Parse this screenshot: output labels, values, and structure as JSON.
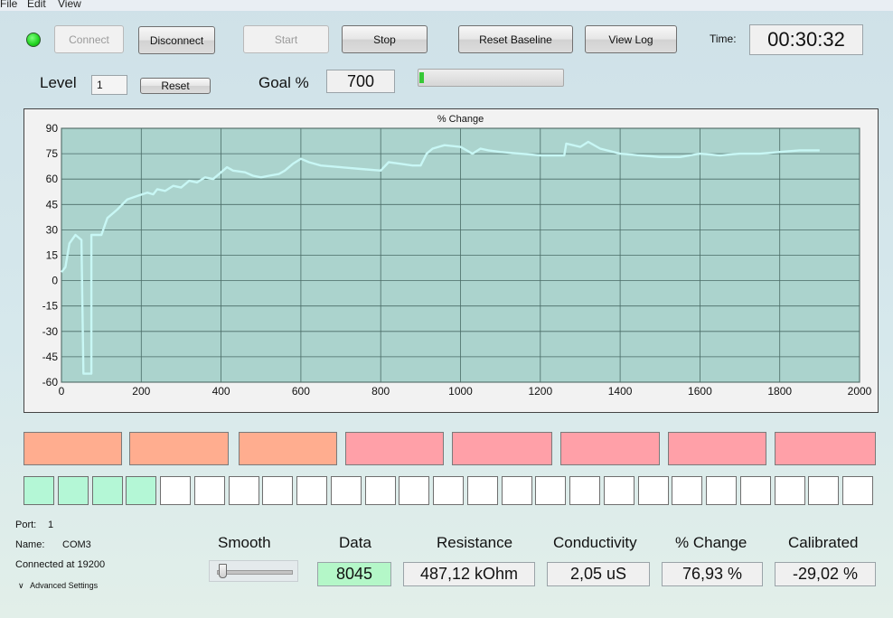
{
  "menu": [
    "File",
    "Edit",
    "View"
  ],
  "colors": {
    "led": "#1fd31f",
    "plot_bg": "#abd3cd",
    "series": "#c8f7f5",
    "orange": "#ffad8f",
    "pink": "#ffa0a8",
    "green_cell": "#b4f7d6",
    "progress": "#37c837",
    "data_bg": "#b4f7c8"
  },
  "toolbar": {
    "connect": "Connect",
    "disconnect": "Disconnect",
    "start": "Start",
    "stop": "Stop",
    "reset_baseline": "Reset Baseline",
    "view_log": "View Log",
    "time_label": "Time:",
    "time_value": "00:30:32"
  },
  "level": {
    "label": "Level",
    "value": "1",
    "reset": "Reset"
  },
  "goal": {
    "label": "Goal %",
    "value": "700",
    "progress": 0.011
  },
  "chart_data": {
    "type": "line",
    "title": "% Change",
    "xlabel": "",
    "ylabel": "",
    "xlim": [
      0,
      2000
    ],
    "ylim": [
      -60,
      90
    ],
    "xticks": [
      0,
      200,
      400,
      600,
      800,
      1000,
      1200,
      1400,
      1600,
      1800,
      2000
    ],
    "yticks": [
      90,
      75,
      60,
      45,
      30,
      15,
      0,
      -15,
      -30,
      -45,
      -60
    ],
    "grid": true,
    "series": [
      {
        "x": [
          0,
          10,
          20,
          35,
          50,
          55,
          55,
          75,
          75,
          100,
          115,
          140,
          165,
          190,
          215,
          230,
          240,
          260,
          280,
          300,
          320,
          340,
          360,
          380,
          400,
          415,
          430,
          460,
          480,
          500,
          520,
          545,
          560,
          580,
          600,
          620,
          650,
          700,
          750,
          800,
          820,
          850,
          880,
          900,
          915,
          930,
          960,
          1000,
          1030,
          1050,
          1070,
          1100,
          1150,
          1200,
          1260,
          1265,
          1300,
          1320,
          1350,
          1400,
          1450,
          1500,
          1550,
          1600,
          1650,
          1700,
          1750,
          1800,
          1850,
          1900
        ],
        "y": [
          5,
          8,
          22,
          27,
          24,
          -55,
          -55,
          -55,
          27,
          27,
          37,
          42,
          48,
          50,
          52,
          51,
          54,
          53,
          56,
          55,
          59,
          58,
          61,
          60,
          64,
          67,
          65,
          64,
          62,
          61,
          62,
          63,
          65,
          69,
          72,
          70,
          68,
          67,
          66,
          65,
          70,
          69,
          68,
          68,
          75,
          78,
          80,
          79,
          75,
          78,
          77,
          76,
          75,
          74,
          74,
          81,
          79,
          82,
          78,
          75,
          74,
          73,
          73,
          75,
          74,
          75,
          75,
          76,
          77,
          77
        ]
      }
    ]
  },
  "tiles_top": [
    {
      "color": "orange"
    },
    {
      "color": "orange"
    },
    {
      "color": "orange"
    },
    {
      "color": "pink"
    },
    {
      "color": "pink"
    },
    {
      "color": "pink"
    },
    {
      "color": "pink"
    },
    {
      "color": "pink"
    }
  ],
  "cells": {
    "total": 25,
    "filled": 4
  },
  "status": {
    "port_label": "Port:",
    "port_value": "1",
    "name_label": "Name:",
    "name_value": "COM3",
    "connected": "Connected at 19200",
    "advanced": "Advanced Settings"
  },
  "smooth": {
    "label": "Smooth",
    "level": 0.03
  },
  "readouts": [
    {
      "label": "Data",
      "value": "8045"
    },
    {
      "label": "Resistance",
      "value": "487,12 kOhm"
    },
    {
      "label": "Conductivity",
      "value": "2,05 uS"
    },
    {
      "label": "% Change",
      "value": "76,93 %"
    },
    {
      "label": "Calibrated",
      "value": "-29,02 %"
    }
  ]
}
